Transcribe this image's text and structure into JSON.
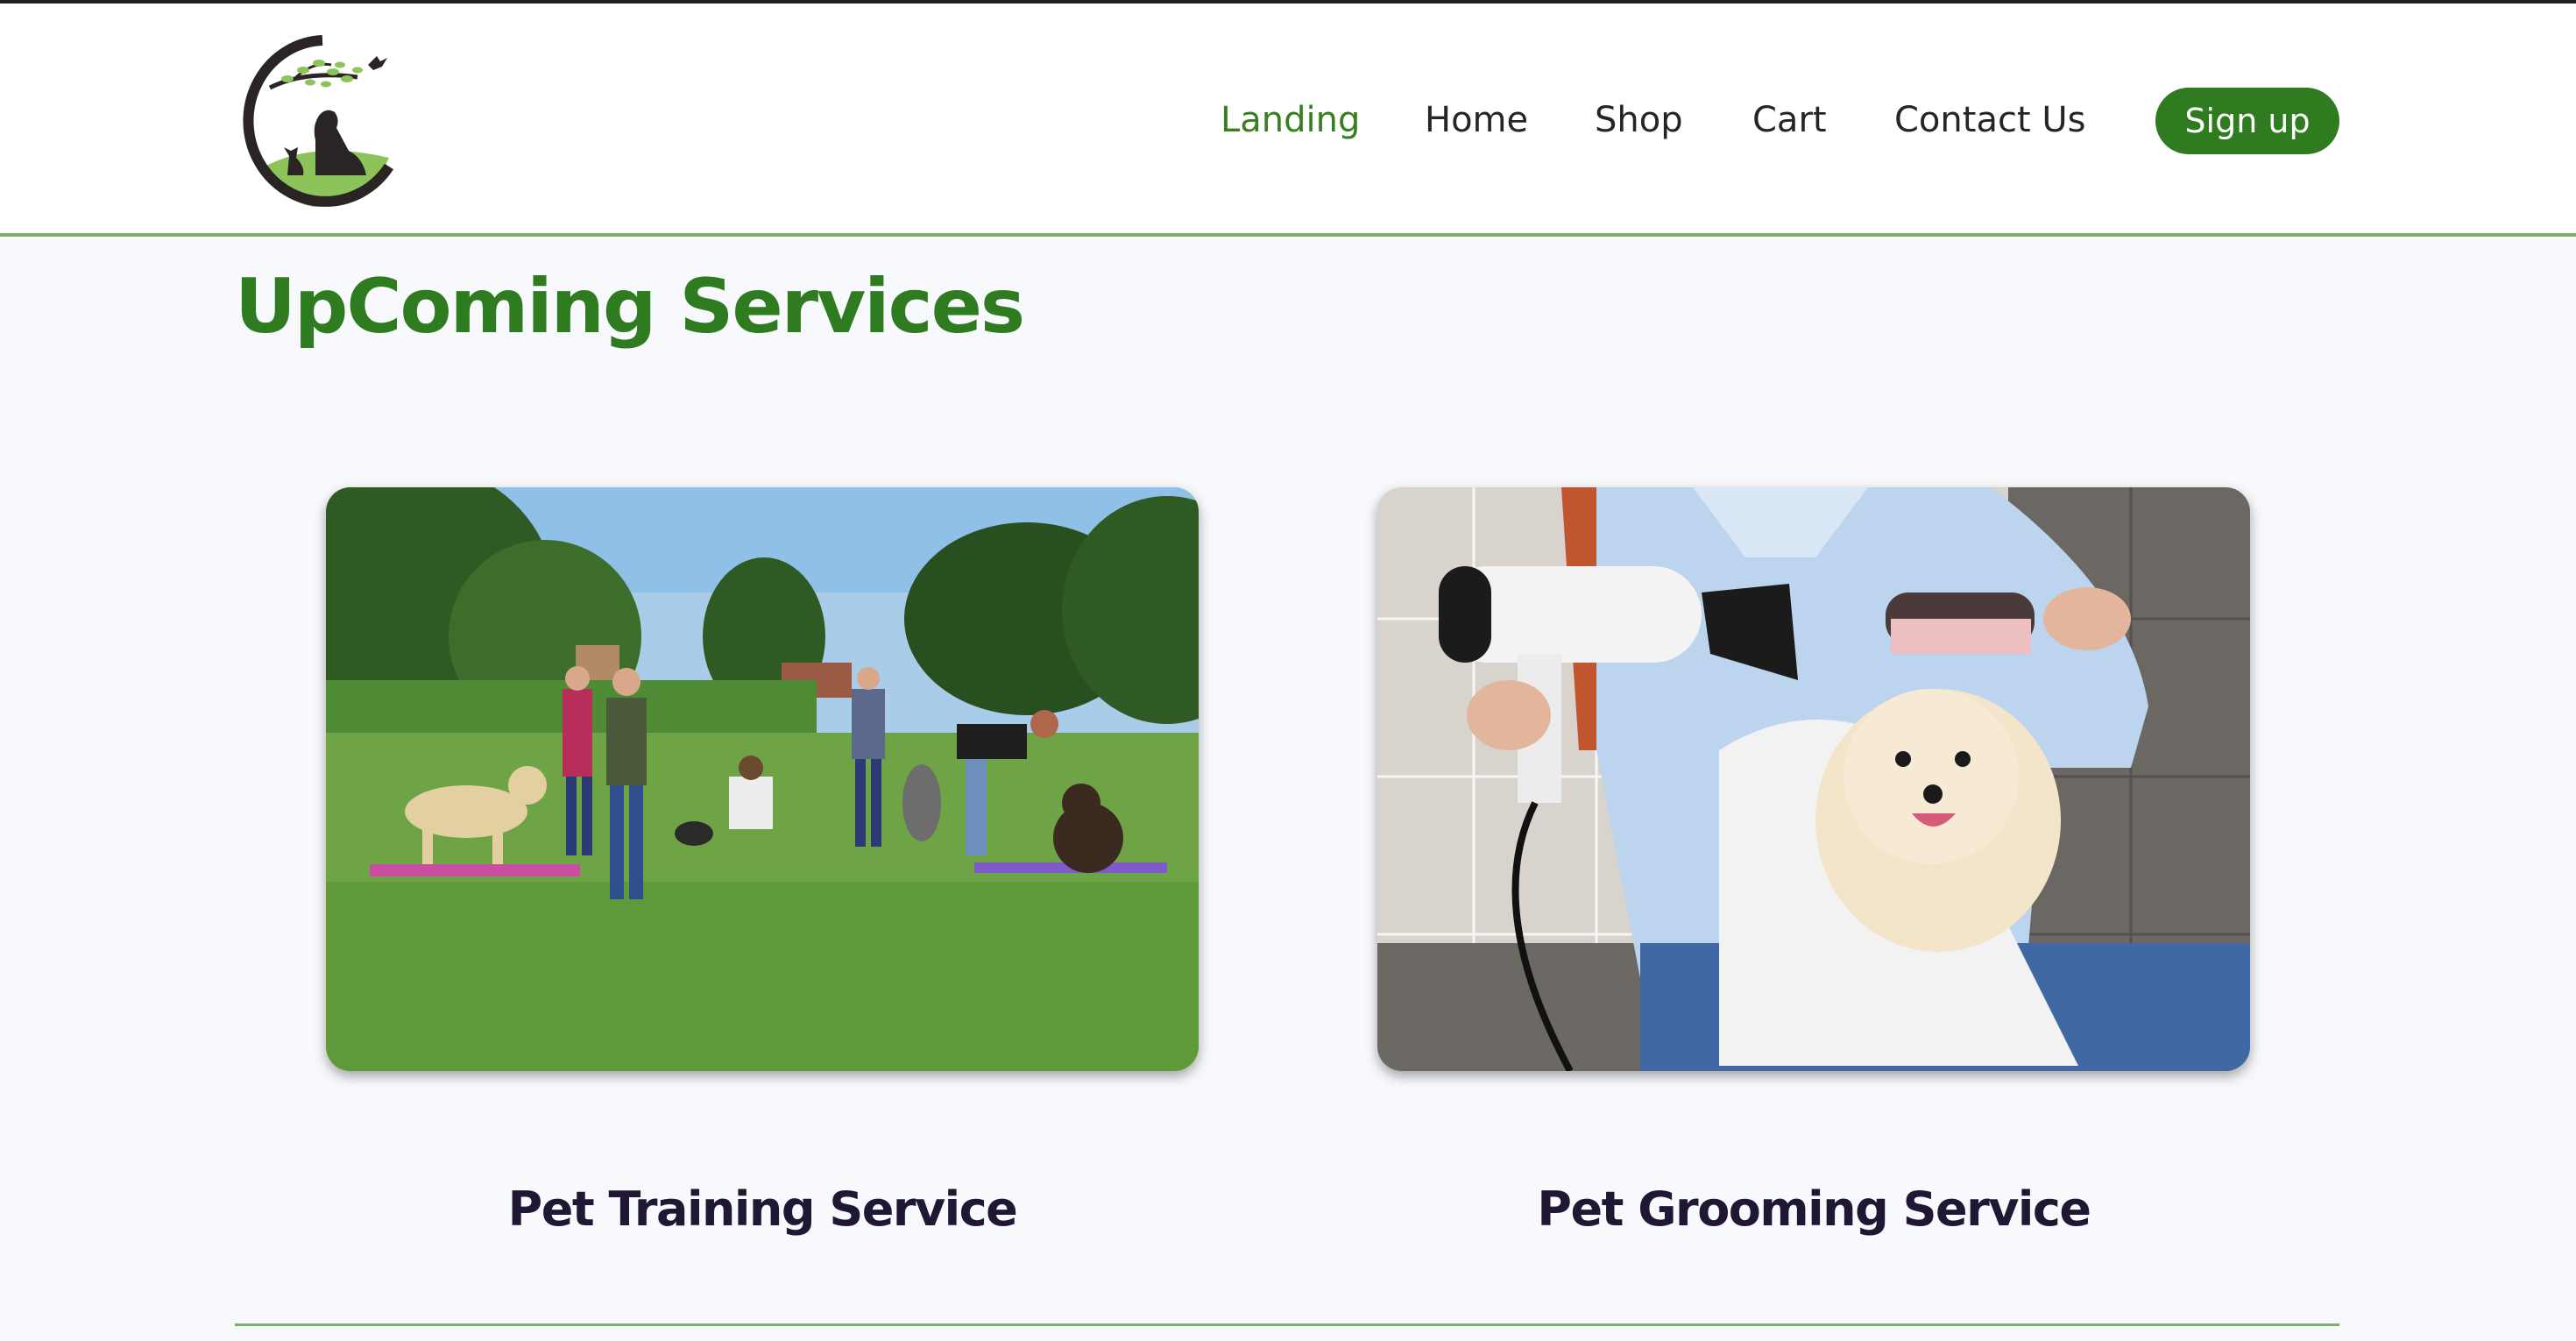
{
  "header": {
    "logo_name": "pet-care-logo",
    "nav": {
      "landing": "Landing",
      "home": "Home",
      "shop": "Shop",
      "cart": "Cart",
      "contact": "Contact Us"
    },
    "signup_label": "Sign up"
  },
  "main": {
    "title": "UpComing Services",
    "services": [
      {
        "label": "Pet Training Service",
        "image": "dogs-training-in-park-photo"
      },
      {
        "label": "Pet Grooming Service",
        "image": "pomeranian-grooming-photo"
      }
    ]
  },
  "colors": {
    "brand_green": "#2f7b1f",
    "nav_active": "#37801f",
    "divider": "#7bb06a",
    "card_title": "#1f1733",
    "background": "#f8f9fc"
  }
}
